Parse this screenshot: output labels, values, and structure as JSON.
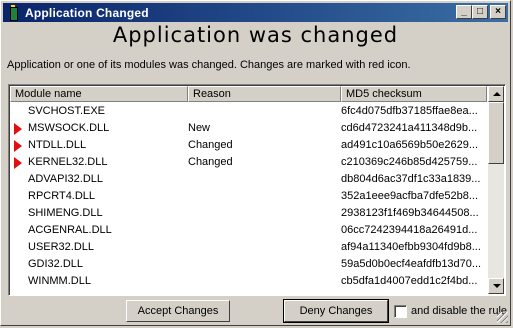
{
  "window": {
    "title": "Application Changed"
  },
  "titlebar_buttons": {
    "minimize": "_",
    "maximize": "□",
    "close": "×"
  },
  "heading": "Application was changed",
  "description": "Application or one of its modules was changed. Changes are marked with red icon.",
  "table": {
    "columns": [
      "Module name",
      "Reason",
      "MD5 checksum"
    ],
    "rows": [
      {
        "name": "SVCHOST.EXE",
        "reason": "",
        "md5": "6fc4d075dfb37185ffae8ea...",
        "changed": false
      },
      {
        "name": "MSWSOCK.DLL",
        "reason": "New",
        "md5": "cd6d4723241a411348d9b...",
        "changed": true
      },
      {
        "name": "NTDLL.DLL",
        "reason": "Changed",
        "md5": "ad491c10a6569b50e2629...",
        "changed": true
      },
      {
        "name": "KERNEL32.DLL",
        "reason": "Changed",
        "md5": "c210369c246b85d425759...",
        "changed": true
      },
      {
        "name": "ADVAPI32.DLL",
        "reason": "",
        "md5": "db804d6ac37df1c33a1839...",
        "changed": false
      },
      {
        "name": "RPCRT4.DLL",
        "reason": "",
        "md5": "352a1eee9acfba7dfe52b8...",
        "changed": false
      },
      {
        "name": "SHIMENG.DLL",
        "reason": "",
        "md5": "2938123f1f469b34644508...",
        "changed": false
      },
      {
        "name": "ACGENRAL.DLL",
        "reason": "",
        "md5": "06cc7242394418a26491d...",
        "changed": false
      },
      {
        "name": "USER32.DLL",
        "reason": "",
        "md5": "af94a11340efbb9304fd9b8...",
        "changed": false
      },
      {
        "name": "GDI32.DLL",
        "reason": "",
        "md5": "59a5d0b0ecf4eafdfb13d70...",
        "changed": false
      },
      {
        "name": "WINMM.DLL",
        "reason": "",
        "md5": "cb5dfa1d4007edd1c2f4bd...",
        "changed": false
      }
    ]
  },
  "buttons": {
    "accept": "Accept Changes",
    "deny": "Deny Changes"
  },
  "checkbox": {
    "label": "and disable the rule",
    "checked": false
  },
  "colors": {
    "titlebar": "#0a246a",
    "changed_marker": "#e01010",
    "face": "#d4d0c8"
  }
}
